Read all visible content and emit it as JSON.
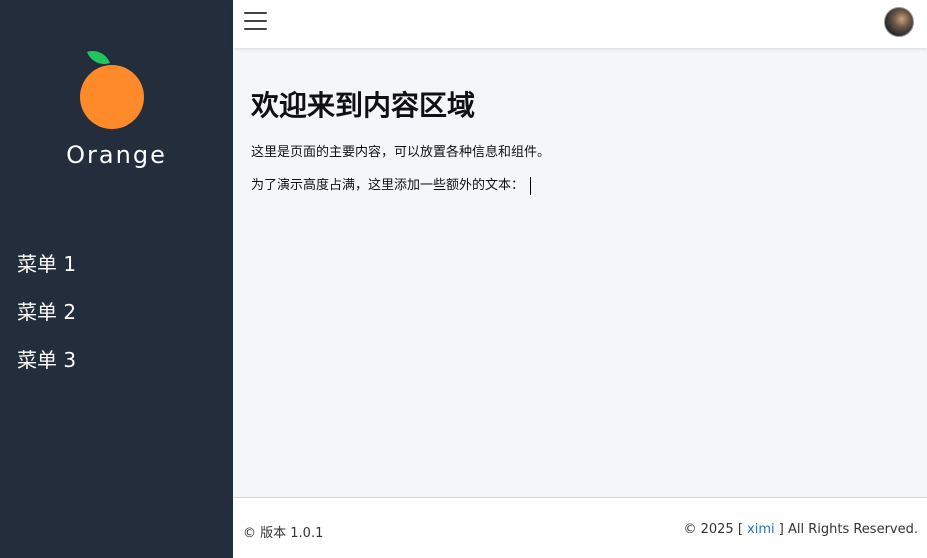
{
  "sidebar": {
    "brand": "Orange",
    "menu": [
      {
        "label": "菜单 1"
      },
      {
        "label": "菜单 2"
      },
      {
        "label": "菜单 3"
      }
    ]
  },
  "header": {
    "menu_icon": "hamburger-icon",
    "avatar_icon": "avatar-image"
  },
  "content": {
    "title": "欢迎来到内容区域",
    "paragraph1": "这里是页面的主要内容，可以放置各种信息和组件。",
    "paragraph2": "为了演示高度占满，这里添加一些额外的文本："
  },
  "footer": {
    "version": "© 版本 1.0.1",
    "copyright_prefix": "© 2025 [",
    "author": "ximi",
    "copyright_suffix": "] All Rights Reserved."
  },
  "colors": {
    "sidebar_bg": "#232d3b",
    "content_bg": "#f5f6fa",
    "link": "#2b72c4",
    "logo_orange": "#ff8a2a",
    "logo_leaf": "#22c55e"
  }
}
